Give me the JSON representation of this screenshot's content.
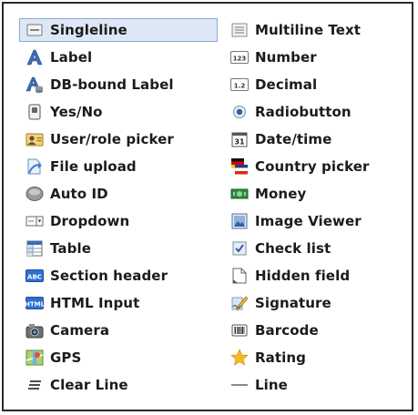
{
  "left_column": [
    {
      "label": "Singleline",
      "icon": "singleline-icon",
      "selected": true
    },
    {
      "label": "Label",
      "icon": "label-icon"
    },
    {
      "label": "DB-bound Label",
      "icon": "db-bound-label-icon"
    },
    {
      "label": "Yes/No",
      "icon": "yes-no-icon"
    },
    {
      "label": "User/role picker",
      "icon": "user-role-picker-icon"
    },
    {
      "label": "File upload",
      "icon": "file-upload-icon"
    },
    {
      "label": "Auto ID",
      "icon": "auto-id-icon"
    },
    {
      "label": "Dropdown",
      "icon": "dropdown-icon"
    },
    {
      "label": "Table",
      "icon": "table-icon"
    },
    {
      "label": "Section header",
      "icon": "section-header-icon",
      "icon_text": "ABC"
    },
    {
      "label": "HTML Input",
      "icon": "html-input-icon",
      "icon_text": "HTML"
    },
    {
      "label": "Camera",
      "icon": "camera-icon"
    },
    {
      "label": "GPS",
      "icon": "gps-icon"
    },
    {
      "label": "Clear Line",
      "icon": "clear-line-icon"
    }
  ],
  "right_column": [
    {
      "label": "Multiline Text",
      "icon": "multiline-text-icon"
    },
    {
      "label": "Number",
      "icon": "number-icon",
      "icon_text": "123"
    },
    {
      "label": "Decimal",
      "icon": "decimal-icon",
      "icon_text": "1.2"
    },
    {
      "label": "Radiobutton",
      "icon": "radiobutton-icon"
    },
    {
      "label": "Date/time",
      "icon": "date-time-icon",
      "icon_text": "31"
    },
    {
      "label": "Country picker",
      "icon": "country-picker-icon"
    },
    {
      "label": "Money",
      "icon": "money-icon"
    },
    {
      "label": "Image Viewer",
      "icon": "image-viewer-icon"
    },
    {
      "label": "Check list",
      "icon": "check-list-icon"
    },
    {
      "label": "Hidden field",
      "icon": "hidden-field-icon"
    },
    {
      "label": "Signature",
      "icon": "signature-icon"
    },
    {
      "label": "Barcode",
      "icon": "barcode-icon"
    },
    {
      "label": "Rating",
      "icon": "rating-icon"
    },
    {
      "label": "Line",
      "icon": "line-icon"
    }
  ],
  "colors": {
    "selected_bg": "#dde7f6",
    "selected_border": "#8eaadb",
    "panel_border": "#2b2b2b",
    "text": "#1b1b1b"
  }
}
